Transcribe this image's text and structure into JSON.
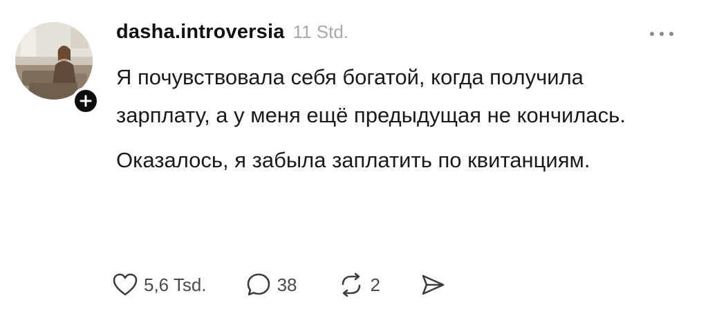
{
  "post": {
    "username": "dasha.introversia",
    "timestamp": "11 Std.",
    "paragraphs": [
      "Я почувствовала себя богатой, когда получила зарплату, а у меня ещё предыдущая не кончилась.",
      "Оказалось, я забыла заплатить по квитанциям."
    ],
    "actions": {
      "likes": "5,6 Tsd.",
      "replies": "38",
      "reposts": "2"
    }
  },
  "icons": {
    "avatar": "profile-photo",
    "follow": "plus-icon",
    "more": "more-dots-icon",
    "like": "heart-icon",
    "reply": "speech-bubble-icon",
    "repost": "repost-arrows-icon",
    "share": "send-icon"
  },
  "colors": {
    "text": "#1a1a1a",
    "muted": "#a9a9a9",
    "icon": "#4a4a4a",
    "badge": "#0d0d0d"
  }
}
